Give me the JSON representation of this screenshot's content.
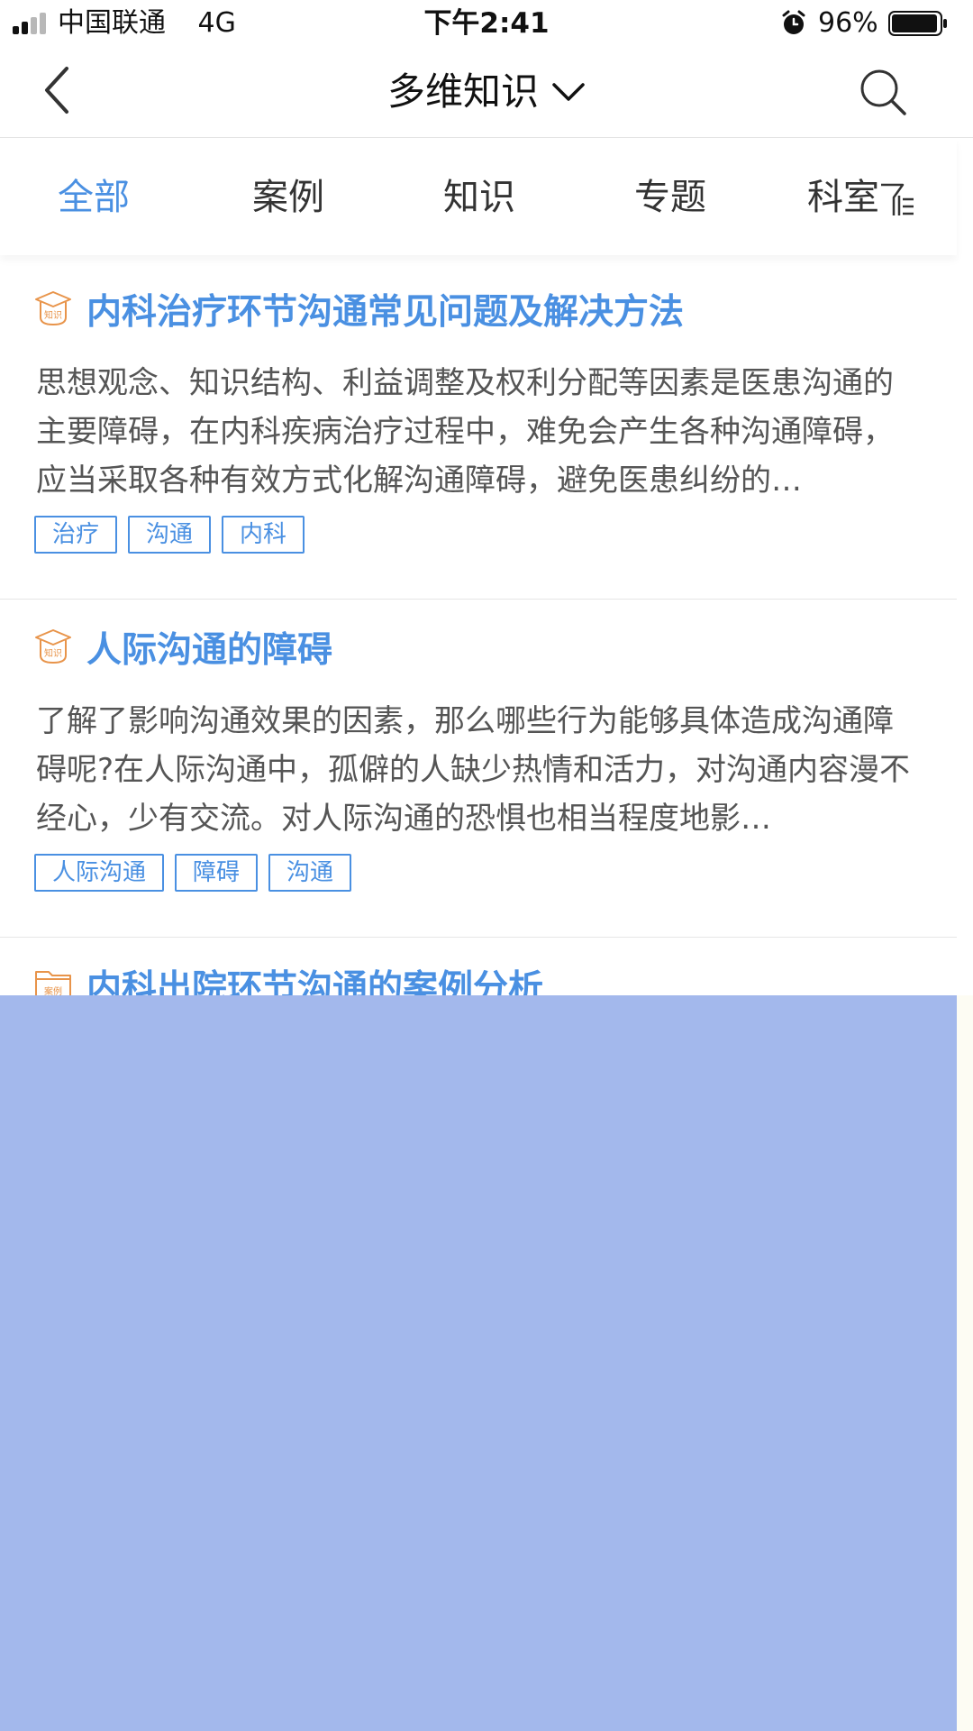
{
  "status_bar": {
    "carrier": "中国联通",
    "network": "4G",
    "time": "下午2:41",
    "battery": "96%"
  },
  "nav": {
    "title": "多维知识"
  },
  "tabs": [
    {
      "label": "全部",
      "active": true
    },
    {
      "label": "案例",
      "active": false
    },
    {
      "label": "知识",
      "active": false
    },
    {
      "label": "专题",
      "active": false
    },
    {
      "label": "科室",
      "active": false
    }
  ],
  "items": [
    {
      "type": "知识",
      "title": "内科治疗环节沟通常见问题及解决方法",
      "desc": "思想观念、知识结构、利益调整及权利分配等因素是医患沟通的主要障碍，在内科疾病治疗过程中，难免会产生各种沟通障碍，应当采取各种有效方式化解沟通障碍，避免医患纠纷的…",
      "tags": [
        "治疗",
        "沟通",
        "内科"
      ]
    },
    {
      "type": "知识",
      "title": "人际沟通的障碍",
      "desc": "了解了影响沟通效果的因素，那么哪些行为能够具体造成沟通障碍呢?在人际沟通中，孤僻的人缺少热情和活力，对沟通内容漫不经心，少有交流。对人际沟通的恐惧也相当程度地影…",
      "tags": [
        "人际沟通",
        "障碍",
        "沟通"
      ]
    },
    {
      "type": "案例",
      "title": "内科出院环节沟通的案例分析"
    }
  ],
  "colors": {
    "accent": "#4a90e2",
    "icon_orange": "#e8944a",
    "overlay": "#a3b8ec"
  },
  "icons": [
    "signal-icon",
    "alarm-icon",
    "battery-icon",
    "back-icon",
    "chevron-down-icon",
    "search-icon",
    "filter-icon",
    "knowledge-icon",
    "case-icon"
  ]
}
